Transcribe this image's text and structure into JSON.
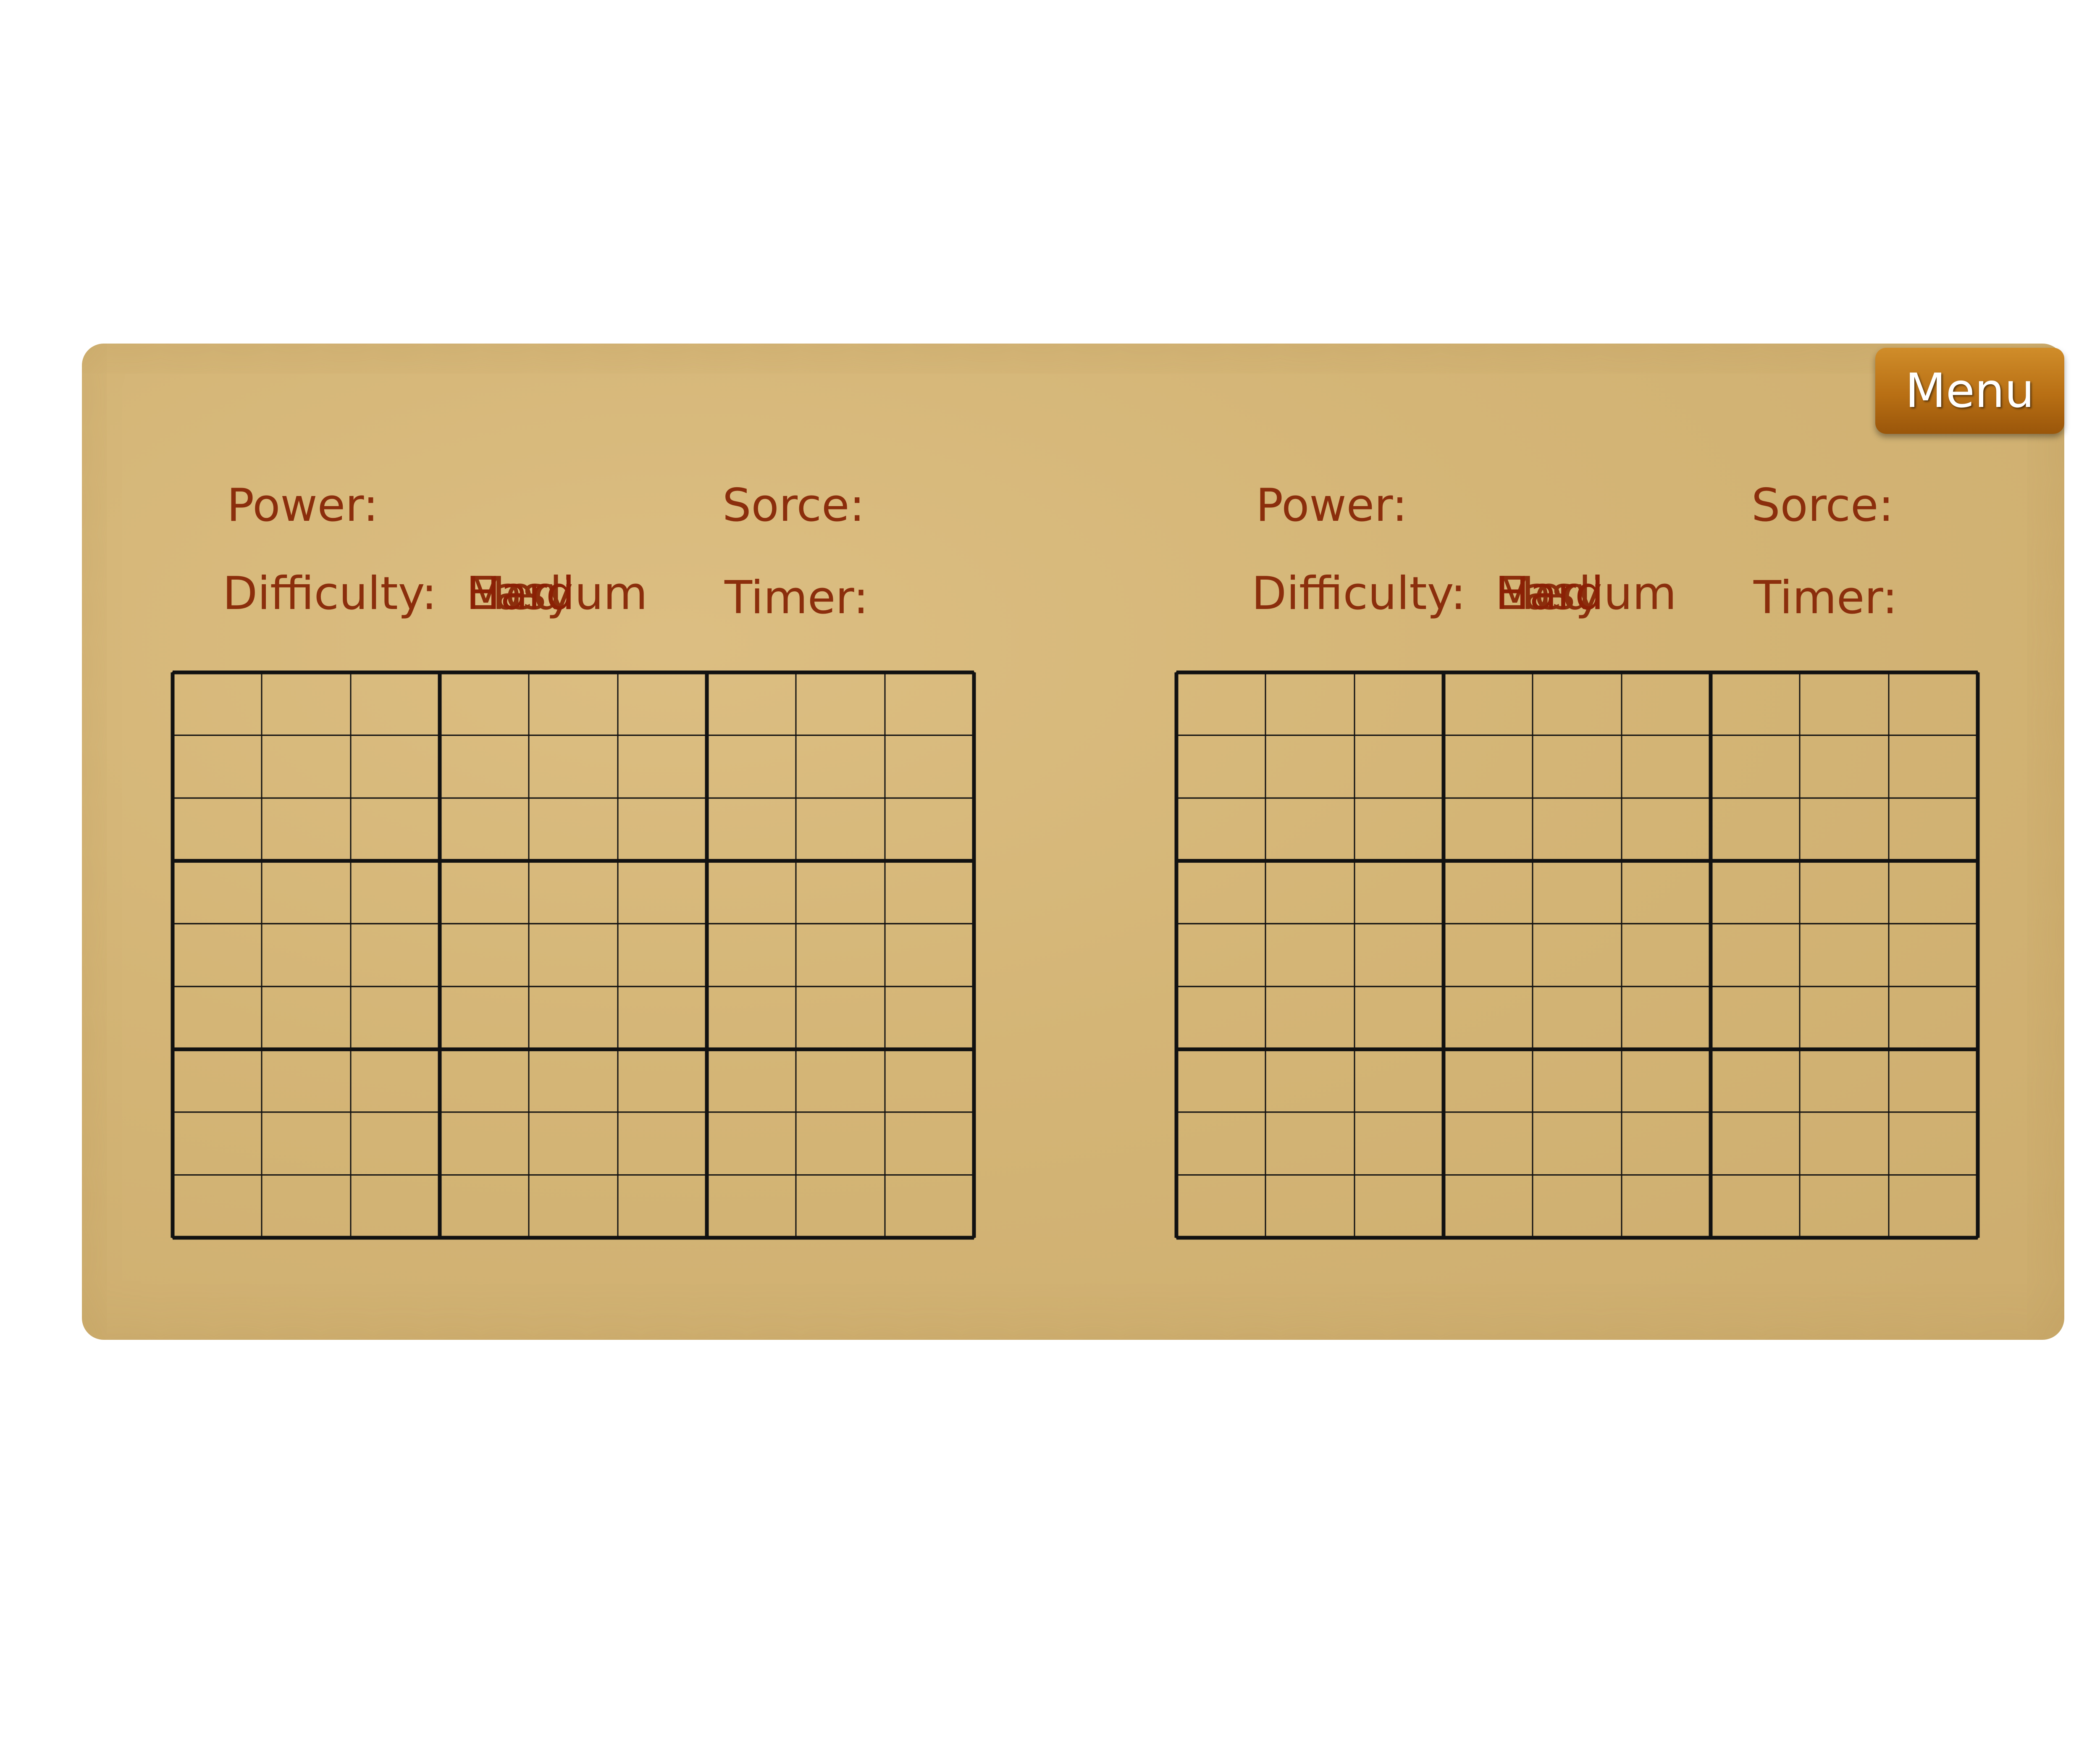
{
  "menu": {
    "label": "Menu"
  },
  "colors": {
    "text": "#8b2e0c",
    "board": "#d4b576",
    "button": "#b86f14",
    "grid_line": "#111111"
  },
  "players": [
    {
      "power_label": "Power:",
      "score_label": "Sorce:",
      "difficulty_label": "Difficulty:",
      "timer_label": "Timer:",
      "difficulty_options": [
        "Easy",
        "Medium",
        "Hard"
      ]
    },
    {
      "power_label": "Power:",
      "score_label": "Sorce:",
      "difficulty_label": "Difficulty:",
      "timer_label": "Timer:",
      "difficulty_options": [
        "Easy",
        "Medium",
        "Hard"
      ]
    }
  ],
  "grid": {
    "rows": 9,
    "cols": 9,
    "box_rows": 3,
    "box_cols": 3
  }
}
